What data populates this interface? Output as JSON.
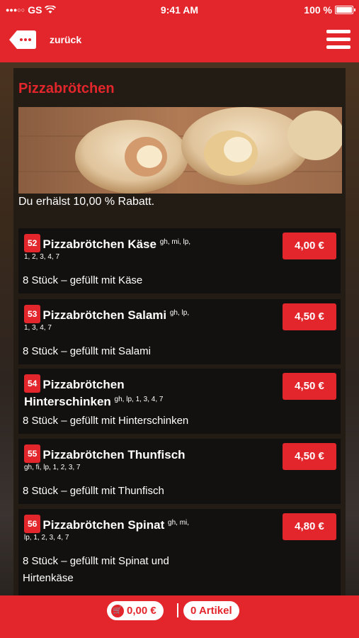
{
  "statusbar": {
    "carrier": "GS",
    "time": "9:41 AM",
    "battery": "100 %"
  },
  "navbar": {
    "back_label": "zurück"
  },
  "category": {
    "title": "Pizzabrötchen",
    "discount_text": "Du erhälst 10,00 % Rabatt."
  },
  "items": [
    {
      "num": "52",
      "name": "Pizzabrötchen Käse",
      "allergens_a": "gh, mi, lp,",
      "allergens_b": "1, 2, 3, 4, 7",
      "desc": "8 Stück – gefüllt mit Käse",
      "price": "4,00 €"
    },
    {
      "num": "53",
      "name": "Pizzabrötchen Salami",
      "allergens_a": "gh, lp,",
      "allergens_b": "1, 3, 4, 7",
      "desc": "8 Stück – gefüllt mit Salami",
      "price": "4,50 €"
    },
    {
      "num": "54",
      "name": "Pizzabrötchen",
      "name2": "Hinterschinken",
      "allergens_a": "gh, lp, 1, 3, 4, 7",
      "desc": "8 Stück – gefüllt mit Hinterschinken",
      "price": "4,50 €"
    },
    {
      "num": "55",
      "name": "Pizzabrötchen Thunfisch",
      "allergens_b": "gh, fi, lp, 1, 2, 3, 7",
      "desc": "8 Stück – gefüllt mit Thunfisch",
      "price": "4,50 €"
    },
    {
      "num": "56",
      "name": "Pizzabrötchen Spinat",
      "allergens_a": "gh, mi,",
      "allergens_b": "lp, 1, 2, 3, 4, 7",
      "desc": "8 Stück – gefüllt mit Spinat und",
      "desc2": "Hirtenkäse",
      "price": "4,80 €"
    }
  ],
  "bottombar": {
    "cart_total": "0,00 €",
    "cart_count": "0 Artikel"
  },
  "colors": {
    "accent": "#e3262c",
    "panel": "#231c14",
    "item_bg": "#121110"
  }
}
